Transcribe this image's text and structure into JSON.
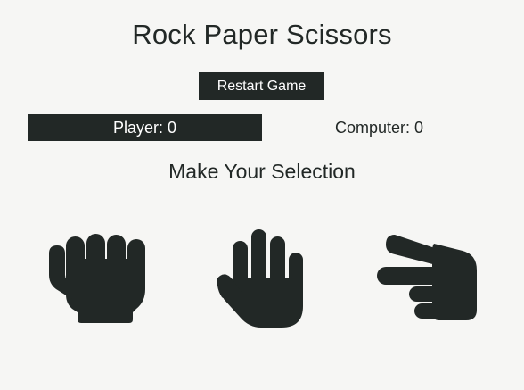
{
  "app": {
    "title": "Rock Paper Scissors"
  },
  "controls": {
    "restart_label": "Restart Game"
  },
  "scoreboard": {
    "player_label": "Player:",
    "player_score": "0",
    "computer_label": "Computer:",
    "computer_score": "0"
  },
  "selection": {
    "heading": "Make Your Selection",
    "choices": [
      {
        "id": "rock",
        "icon": "hand-rock-icon"
      },
      {
        "id": "paper",
        "icon": "hand-paper-icon"
      },
      {
        "id": "scissors",
        "icon": "hand-scissors-icon"
      }
    ]
  },
  "colors": {
    "background": "#f6f6f4",
    "dark": "#222826",
    "light_text": "#ffffff"
  }
}
